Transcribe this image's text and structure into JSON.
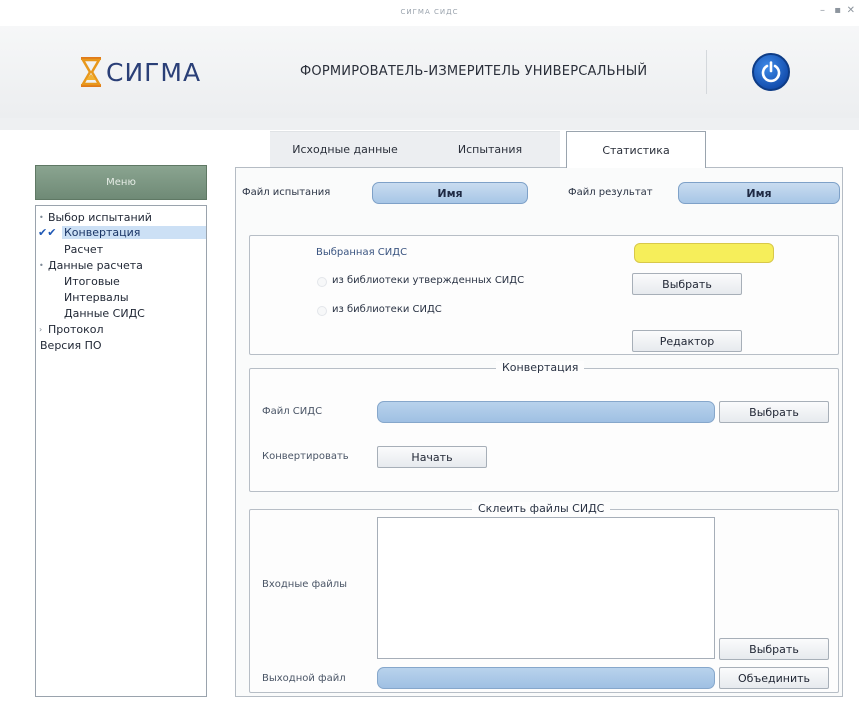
{
  "window": {
    "title": "СИГМА СИДС",
    "controls": [
      "–",
      "▪",
      "✕"
    ]
  },
  "header": {
    "logo_text": "СИГМА",
    "app_title": "ФОРМИРОВАТЕЛЬ-ИЗМЕРИТЕЛЬ УНИВЕРСАЛЬНЫЙ",
    "power_icon": "power-icon",
    "logo_color": "#2a3f77",
    "power_color": "#1550b0"
  },
  "tabs": [
    {
      "label": "Исходные данные",
      "active": false
    },
    {
      "label": "Испытания",
      "active": false
    },
    {
      "label": "Статистика",
      "active": true
    }
  ],
  "sidebar": {
    "header": "Меню",
    "items": [
      {
        "label": "Выбор испытаний",
        "level": 0,
        "bullet": "•"
      },
      {
        "label": "Конвертация",
        "level": 1,
        "selected": true,
        "check": "✔✔"
      },
      {
        "label": "Расчет",
        "level": 1
      },
      {
        "label": "Данные расчета",
        "level": 0,
        "bullet": "•"
      },
      {
        "label": "Итоговые",
        "level": 1
      },
      {
        "label": "Интервалы",
        "level": 1
      },
      {
        "label": "Данные СИДС",
        "level": 1
      },
      {
        "label": "Протокол",
        "level": 0,
        "bullet": "›"
      },
      {
        "label": "Версия ПО",
        "level": 0
      }
    ]
  },
  "files": {
    "test_file_label": "Файл испытания",
    "test_file_value": "Имя",
    "result_file_label": "Файл результат",
    "result_file_value": "Имя"
  },
  "sids_select": {
    "selected_label": "Выбранная СИДС",
    "selected_value": "",
    "option_approved": "из библиотеки утвержденных СИДС",
    "option_library": "из библиотеки СИДС",
    "select_button": "Выбрать",
    "editor_button": "Редактор",
    "highlight_color": "#f6ee5a"
  },
  "conversion": {
    "title": "Конвертация",
    "file_label": "Файл СИДС",
    "file_value": "",
    "select_button": "Выбрать",
    "convert_label": "Конвертировать",
    "start_button": "Начать"
  },
  "merge": {
    "title": "Склеить файлы СИДС",
    "input_label": "Входные файлы",
    "input_files": [],
    "select_button": "Выбрать",
    "output_label": "Выходной файл",
    "output_value": "",
    "merge_button": "Объединить"
  }
}
